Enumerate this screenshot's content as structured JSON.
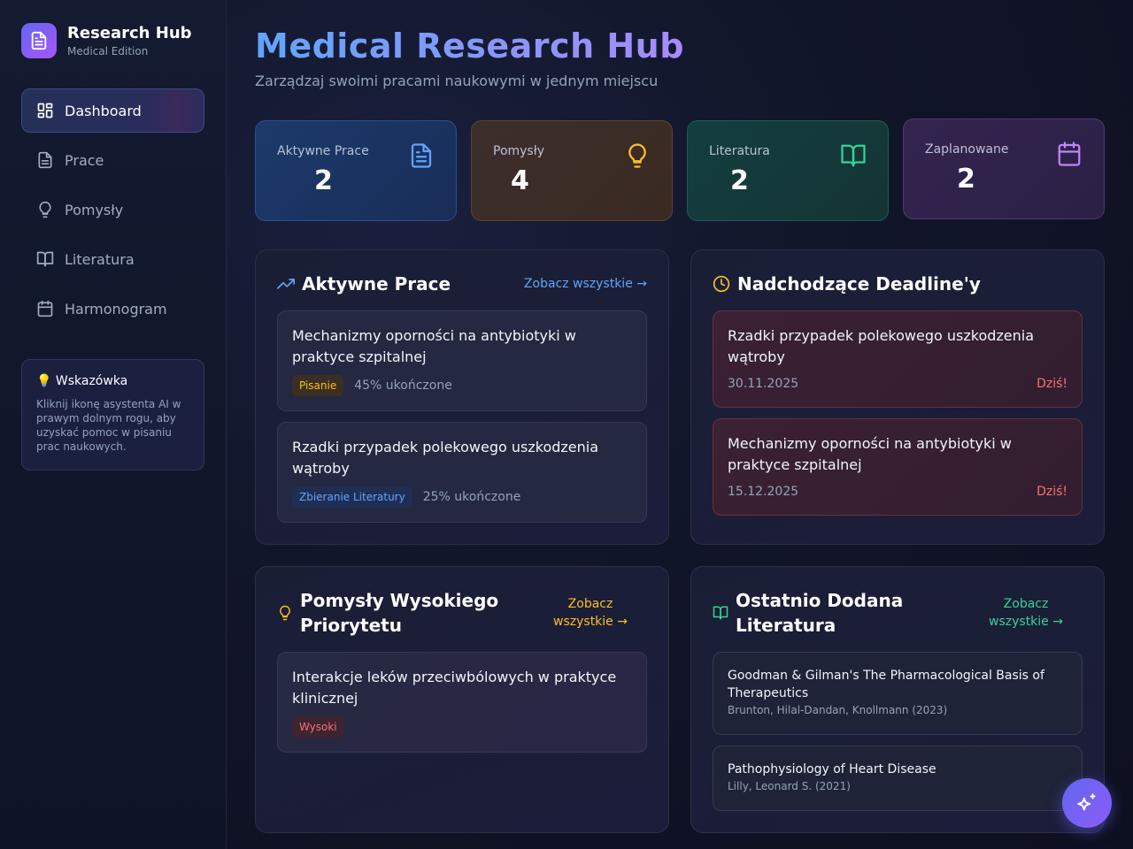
{
  "brand": {
    "title": "Research Hub",
    "subtitle": "Medical Edition"
  },
  "nav": [
    {
      "label": "Dashboard",
      "icon": "dashboard-icon",
      "active": true
    },
    {
      "label": "Prace",
      "icon": "document-icon"
    },
    {
      "label": "Pomysły",
      "icon": "lightbulb-icon"
    },
    {
      "label": "Literatura",
      "icon": "book-icon"
    },
    {
      "label": "Harmonogram",
      "icon": "calendar-icon"
    }
  ],
  "tip": {
    "title": "💡 Wskazówka",
    "text": "Kliknij ikonę asystenta AI w prawym dolnym rogu, aby uzyskać pomoc w pisaniu prac naukowych."
  },
  "header": {
    "title": "Medical Research Hub",
    "subtitle": "Zarządzaj swoimi pracami naukowymi w jednym miejscu"
  },
  "stats": [
    {
      "label": "Aktywne Prace",
      "value": "2",
      "icon": "document-icon",
      "color": "#60a5fa"
    },
    {
      "label": "Pomysły",
      "value": "4",
      "icon": "lightbulb-icon",
      "color": "#fbbf24"
    },
    {
      "label": "Literatura",
      "value": "2",
      "icon": "book-icon",
      "color": "#34d399"
    },
    {
      "label": "Zaplanowane",
      "value": "2",
      "icon": "calendar-icon",
      "color": "#c084fc"
    }
  ],
  "active_works": {
    "title": "Aktywne Prace",
    "link": "Zobacz wszystkie →",
    "items": [
      {
        "title": "Mechanizmy oporności na antybiotyki w praktyce szpitalnej",
        "badge": "Pisanie",
        "progress": "45% ukończone"
      },
      {
        "title": "Rzadki przypadek polekowego uszkodzenia wątroby",
        "badge": "Zbieranie Literatury",
        "progress": "25% ukończone"
      }
    ]
  },
  "deadlines": {
    "title": "Nadchodzące Deadline'y",
    "items": [
      {
        "title": "Rzadki przypadek polekowego uszkodzenia wątroby",
        "date": "30.11.2025",
        "status": "Dziś!"
      },
      {
        "title": "Mechanizmy oporności na antybiotyki w praktyce szpitalnej",
        "date": "15.12.2025",
        "status": "Dziś!"
      }
    ]
  },
  "ideas": {
    "title": "Pomysły Wysokiego Priorytetu",
    "link": "Zobacz wszystkie →",
    "items": [
      {
        "title": "Interakcje leków przeciwbólowych w praktyce klinicznej",
        "badge": "Wysoki"
      }
    ]
  },
  "literature": {
    "title": "Ostatnio Dodana Literatura",
    "link": "Zobacz wszystkie →",
    "items": [
      {
        "title": "Goodman & Gilman's The Pharmacological Basis of Therapeutics",
        "authors": "Brunton, Hilal-Dandan, Knollmann (2023)"
      },
      {
        "title": "Pathophysiology of Heart Disease",
        "authors": "Lilly, Leonard S. (2021)"
      }
    ]
  },
  "colors": {
    "accent": "#6366f1",
    "blue": "#60a5fa",
    "amber": "#fbbf24",
    "green": "#34d399",
    "purple": "#c084fc",
    "red": "#f87171"
  }
}
